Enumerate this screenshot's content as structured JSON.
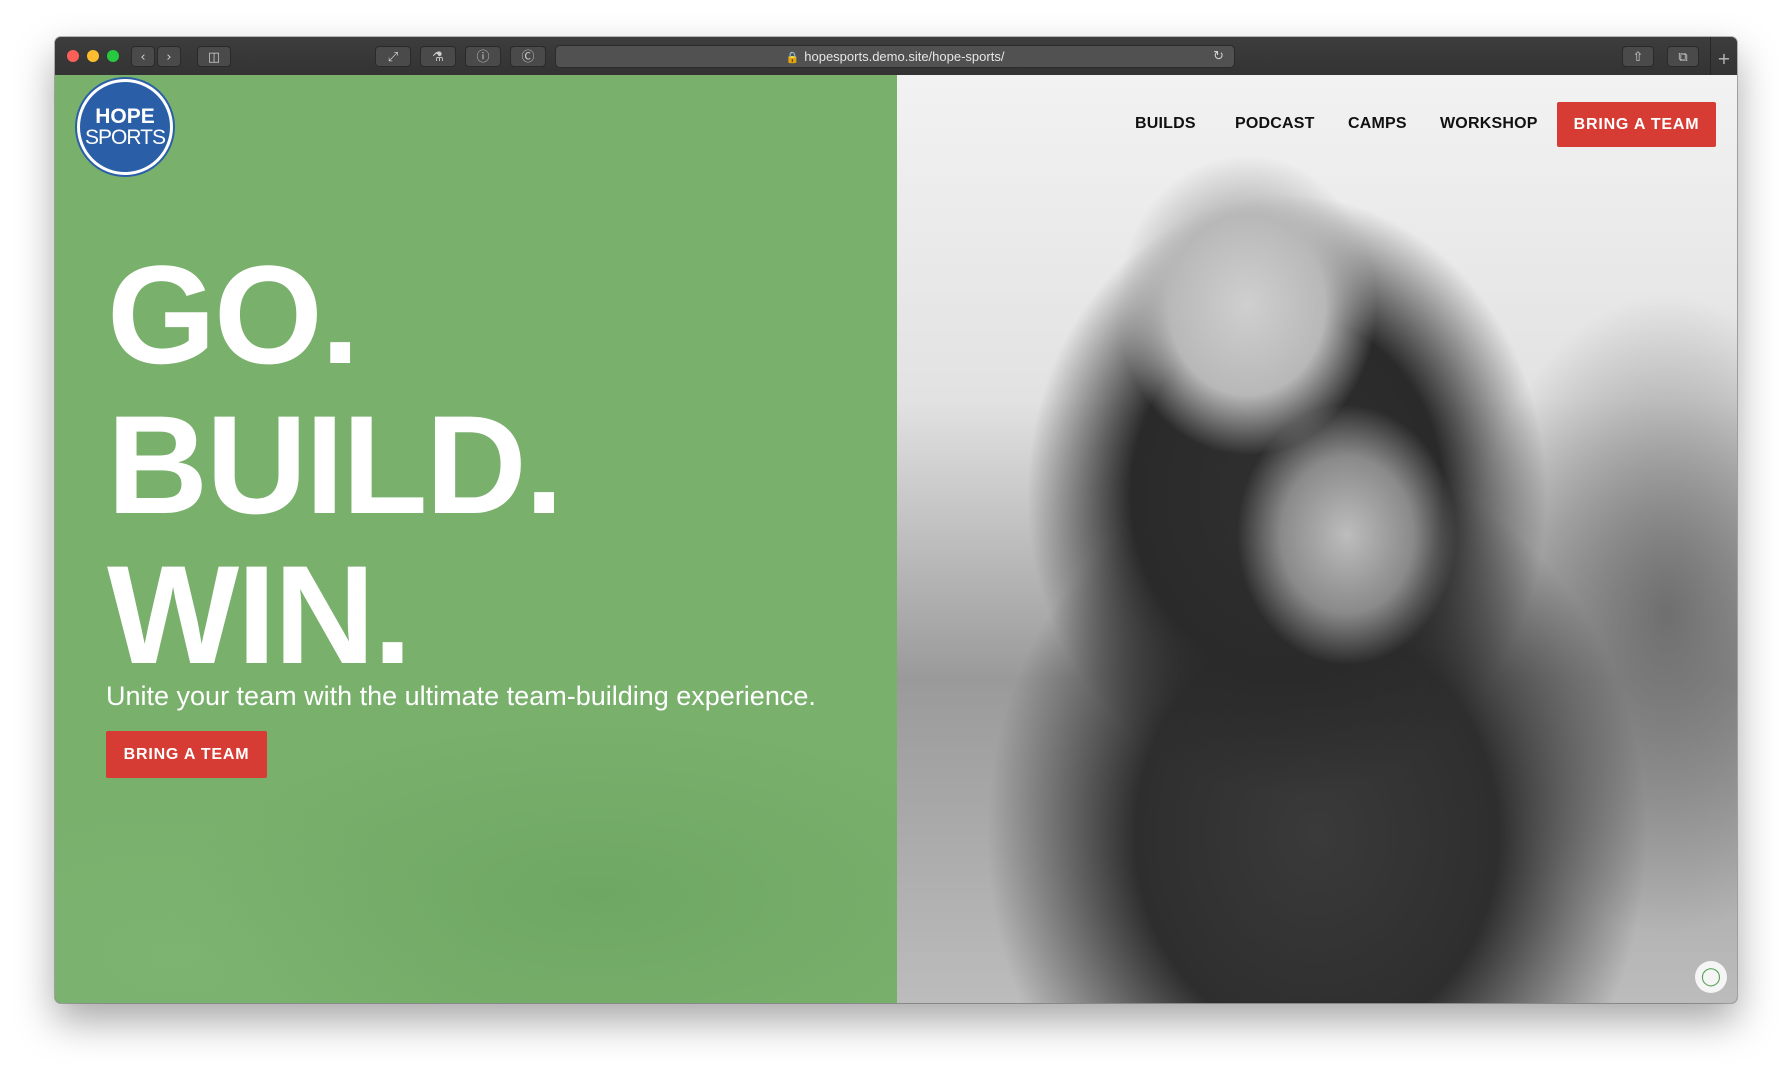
{
  "browser": {
    "url": "hopesports.demo.site/hope-sports/",
    "icons": {
      "back": "chevron-left-icon",
      "forward": "chevron-right-icon",
      "sidebar": "sidebar-icon",
      "lock": "lock-icon",
      "reload": "reload-icon",
      "share": "share-icon",
      "tabs": "tabs-icon",
      "new_tab": "plus-icon"
    }
  },
  "logo": {
    "line1": "HOPE",
    "line2": "SPORTS"
  },
  "nav": {
    "links": [
      "BUILDS",
      "PODCAST",
      "CAMPS",
      "WORKSHOP"
    ],
    "cta": "BRING A TEAM"
  },
  "hero": {
    "headline": [
      "GO.",
      "BUILD.",
      "WIN."
    ],
    "subtitle": "Unite your team with the ultimate team-building experience.",
    "cta": "BRING A TEAM"
  },
  "colors": {
    "green_panel": "#79b06c",
    "cta_red": "#d63c34",
    "logo_blue": "#2a5fa8",
    "logo_accent": "#5aa45a"
  }
}
